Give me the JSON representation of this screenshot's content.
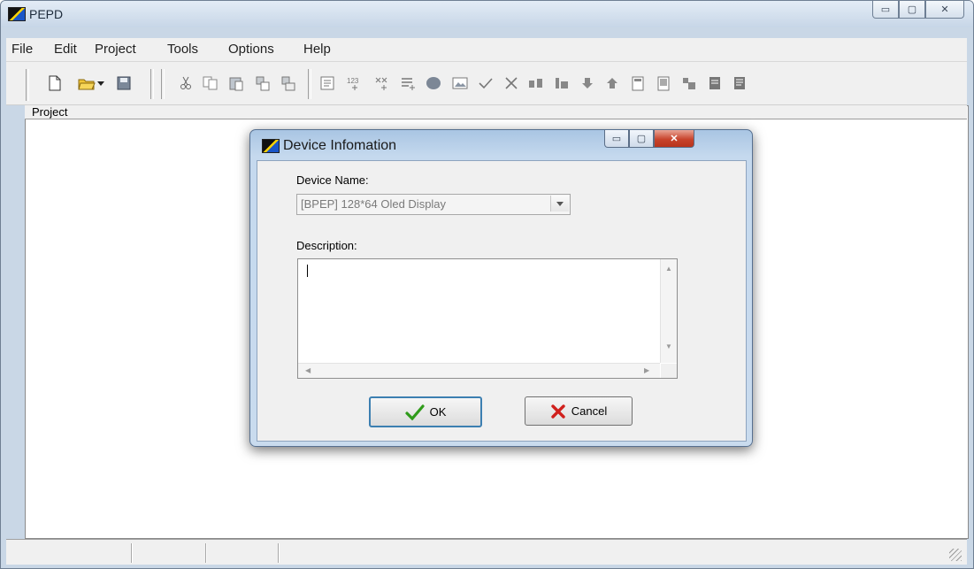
{
  "window": {
    "title": "PEPD",
    "controls": {
      "minimize": "▭",
      "maximize": "▢",
      "close": "✕"
    }
  },
  "menu": [
    "File",
    "Edit",
    "Project",
    "Tools",
    "Options",
    "Help"
  ],
  "toolbar": {
    "icons": [
      "new-file-icon",
      "open-folder-icon",
      "dropdown-arrow-icon",
      "save-icon",
      "cut-icon",
      "copy-icon",
      "paste-icon",
      "copy-device-icon",
      "paste-device-icon",
      "properties-icon",
      "numbers-icon",
      "add-element-icon",
      "list-icon",
      "record-icon",
      "image-icon",
      "check-icon",
      "delete-icon",
      "move-icon",
      "align-icon",
      "move-down-icon",
      "move-up-icon",
      "page-icon",
      "page-alt-icon",
      "export-icon",
      "panel-icon",
      "panel-alt-icon"
    ]
  },
  "project_panel": {
    "label": "Project"
  },
  "dialog": {
    "title": "Device Infomation",
    "device_name_label": "Device Name:",
    "device_name_value": "[BPEP]   128*64 Oled Display",
    "description_label": "Description:",
    "description_value": "",
    "ok_label": "OK",
    "cancel_label": "Cancel",
    "controls": {
      "minimize": "▭",
      "maximize": "▢",
      "close": "✕"
    }
  },
  "colors": {
    "title_bar": "#c7d6e7",
    "dialog_frame": "#c5d9ee",
    "close_button": "#c8442c",
    "ok_check": "#2f9b1a",
    "cancel_x": "#d0201c"
  }
}
